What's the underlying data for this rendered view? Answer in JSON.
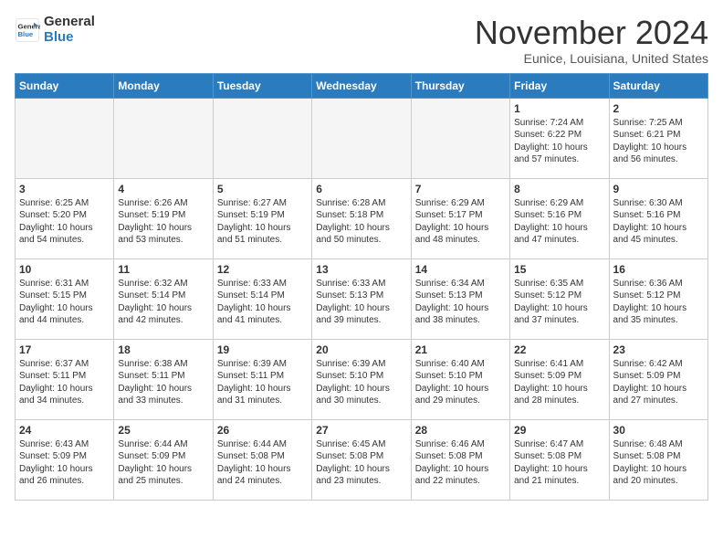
{
  "header": {
    "logo_line1": "General",
    "logo_line2": "Blue",
    "month": "November 2024",
    "location": "Eunice, Louisiana, United States"
  },
  "weekdays": [
    "Sunday",
    "Monday",
    "Tuesday",
    "Wednesday",
    "Thursday",
    "Friday",
    "Saturday"
  ],
  "weeks": [
    [
      {
        "day": "",
        "info": ""
      },
      {
        "day": "",
        "info": ""
      },
      {
        "day": "",
        "info": ""
      },
      {
        "day": "",
        "info": ""
      },
      {
        "day": "",
        "info": ""
      },
      {
        "day": "1",
        "info": "Sunrise: 7:24 AM\nSunset: 6:22 PM\nDaylight: 10 hours\nand 57 minutes."
      },
      {
        "day": "2",
        "info": "Sunrise: 7:25 AM\nSunset: 6:21 PM\nDaylight: 10 hours\nand 56 minutes."
      }
    ],
    [
      {
        "day": "3",
        "info": "Sunrise: 6:25 AM\nSunset: 5:20 PM\nDaylight: 10 hours\nand 54 minutes."
      },
      {
        "day": "4",
        "info": "Sunrise: 6:26 AM\nSunset: 5:19 PM\nDaylight: 10 hours\nand 53 minutes."
      },
      {
        "day": "5",
        "info": "Sunrise: 6:27 AM\nSunset: 5:19 PM\nDaylight: 10 hours\nand 51 minutes."
      },
      {
        "day": "6",
        "info": "Sunrise: 6:28 AM\nSunset: 5:18 PM\nDaylight: 10 hours\nand 50 minutes."
      },
      {
        "day": "7",
        "info": "Sunrise: 6:29 AM\nSunset: 5:17 PM\nDaylight: 10 hours\nand 48 minutes."
      },
      {
        "day": "8",
        "info": "Sunrise: 6:29 AM\nSunset: 5:16 PM\nDaylight: 10 hours\nand 47 minutes."
      },
      {
        "day": "9",
        "info": "Sunrise: 6:30 AM\nSunset: 5:16 PM\nDaylight: 10 hours\nand 45 minutes."
      }
    ],
    [
      {
        "day": "10",
        "info": "Sunrise: 6:31 AM\nSunset: 5:15 PM\nDaylight: 10 hours\nand 44 minutes."
      },
      {
        "day": "11",
        "info": "Sunrise: 6:32 AM\nSunset: 5:14 PM\nDaylight: 10 hours\nand 42 minutes."
      },
      {
        "day": "12",
        "info": "Sunrise: 6:33 AM\nSunset: 5:14 PM\nDaylight: 10 hours\nand 41 minutes."
      },
      {
        "day": "13",
        "info": "Sunrise: 6:33 AM\nSunset: 5:13 PM\nDaylight: 10 hours\nand 39 minutes."
      },
      {
        "day": "14",
        "info": "Sunrise: 6:34 AM\nSunset: 5:13 PM\nDaylight: 10 hours\nand 38 minutes."
      },
      {
        "day": "15",
        "info": "Sunrise: 6:35 AM\nSunset: 5:12 PM\nDaylight: 10 hours\nand 37 minutes."
      },
      {
        "day": "16",
        "info": "Sunrise: 6:36 AM\nSunset: 5:12 PM\nDaylight: 10 hours\nand 35 minutes."
      }
    ],
    [
      {
        "day": "17",
        "info": "Sunrise: 6:37 AM\nSunset: 5:11 PM\nDaylight: 10 hours\nand 34 minutes."
      },
      {
        "day": "18",
        "info": "Sunrise: 6:38 AM\nSunset: 5:11 PM\nDaylight: 10 hours\nand 33 minutes."
      },
      {
        "day": "19",
        "info": "Sunrise: 6:39 AM\nSunset: 5:11 PM\nDaylight: 10 hours\nand 31 minutes."
      },
      {
        "day": "20",
        "info": "Sunrise: 6:39 AM\nSunset: 5:10 PM\nDaylight: 10 hours\nand 30 minutes."
      },
      {
        "day": "21",
        "info": "Sunrise: 6:40 AM\nSunset: 5:10 PM\nDaylight: 10 hours\nand 29 minutes."
      },
      {
        "day": "22",
        "info": "Sunrise: 6:41 AM\nSunset: 5:09 PM\nDaylight: 10 hours\nand 28 minutes."
      },
      {
        "day": "23",
        "info": "Sunrise: 6:42 AM\nSunset: 5:09 PM\nDaylight: 10 hours\nand 27 minutes."
      }
    ],
    [
      {
        "day": "24",
        "info": "Sunrise: 6:43 AM\nSunset: 5:09 PM\nDaylight: 10 hours\nand 26 minutes."
      },
      {
        "day": "25",
        "info": "Sunrise: 6:44 AM\nSunset: 5:09 PM\nDaylight: 10 hours\nand 25 minutes."
      },
      {
        "day": "26",
        "info": "Sunrise: 6:44 AM\nSunset: 5:08 PM\nDaylight: 10 hours\nand 24 minutes."
      },
      {
        "day": "27",
        "info": "Sunrise: 6:45 AM\nSunset: 5:08 PM\nDaylight: 10 hours\nand 23 minutes."
      },
      {
        "day": "28",
        "info": "Sunrise: 6:46 AM\nSunset: 5:08 PM\nDaylight: 10 hours\nand 22 minutes."
      },
      {
        "day": "29",
        "info": "Sunrise: 6:47 AM\nSunset: 5:08 PM\nDaylight: 10 hours\nand 21 minutes."
      },
      {
        "day": "30",
        "info": "Sunrise: 6:48 AM\nSunset: 5:08 PM\nDaylight: 10 hours\nand 20 minutes."
      }
    ]
  ]
}
